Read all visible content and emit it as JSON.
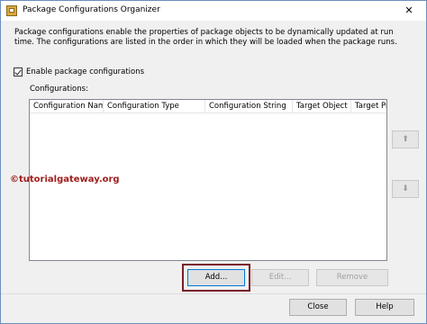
{
  "window": {
    "title": "Package Configurations Organizer",
    "close_glyph": "✕",
    "icon": "package-config-icon"
  },
  "description": "Package configurations enable the properties of package objects to be dynamically updated at run time. The configurations are listed in the order in which they will be loaded when the package runs.",
  "enable_checkbox": {
    "label": "Enable package configurations",
    "checked": true
  },
  "configurations_label": "Configurations:",
  "columns": [
    "Configuration Name",
    "Configuration Type",
    "Configuration String",
    "Target Object",
    "Target Pro"
  ],
  "watermark": "©tutorialgateway.org",
  "side_buttons": {
    "up_glyph": "⬆",
    "down_glyph": "⬇"
  },
  "buttons": {
    "add": "Add...",
    "edit": "Edit...",
    "remove": "Remove",
    "close": "Close",
    "help": "Help"
  },
  "colors": {
    "highlight": "#7a1f2b",
    "watermark": "#a01d1d",
    "focus": "#0078d7"
  }
}
